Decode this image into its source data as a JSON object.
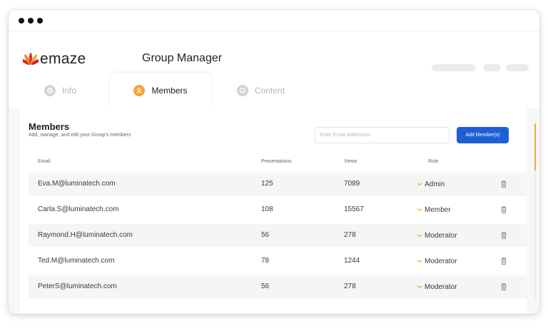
{
  "window": {
    "dots": 3
  },
  "header": {
    "logo_text": "emaze",
    "app_title": "Group Manager"
  },
  "tabs": [
    {
      "label": "Info",
      "icon": "info-icon",
      "active": false
    },
    {
      "label": "Members",
      "icon": "members-icon",
      "active": true
    },
    {
      "label": "Content",
      "icon": "content-icon",
      "active": false
    }
  ],
  "members": {
    "title": "Members",
    "subtitle": "Add, manage, and edit your Group's members",
    "email_placeholder": "Enter Email Addresses",
    "add_button_label": "Add Member(s)",
    "columns": {
      "email": "Email",
      "presentations": "Presentations",
      "views": "Views",
      "role": "Role"
    },
    "rows": [
      {
        "email": "Eva.M@luminatech.com",
        "presentations": "125",
        "views": "7089",
        "role": "Admin"
      },
      {
        "email": "Carla.S@luminatech.com",
        "presentations": "108",
        "views": "15567",
        "role": "Member"
      },
      {
        "email": "Raymond.H@luminatech.com",
        "presentations": "56",
        "views": "278",
        "role": "Moderator"
      },
      {
        "email": "Ted.M@luminatech.com",
        "presentations": "78",
        "views": "1244",
        "role": "Moderator"
      },
      {
        "email": "PeterS@luminatech.com",
        "presentations": "56",
        "views": "278",
        "role": "Moderator"
      }
    ]
  },
  "colors": {
    "accent_orange": "#f5a23b",
    "primary_blue": "#1e5fd6",
    "row_shade": "#f5f5f5",
    "content_bg": "#f7f7f7"
  }
}
